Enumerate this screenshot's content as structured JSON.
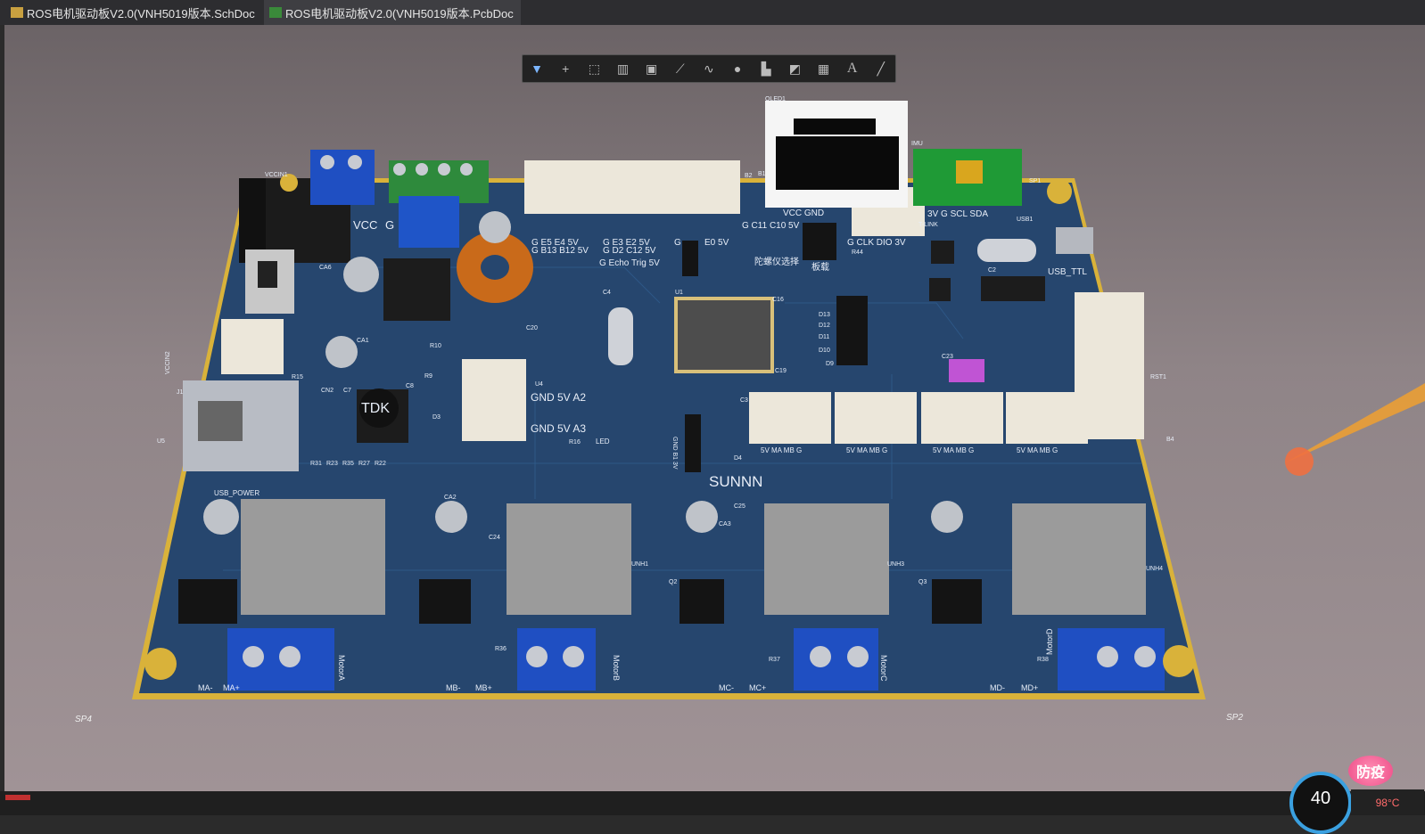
{
  "tabs": [
    {
      "label": "ROS电机驱动板V2.0(VNH5019版本.SchDoc",
      "icon": "schematic-doc-icon"
    },
    {
      "label": "ROS电机驱动板V2.0(VNH5019版本.PcbDoc",
      "icon": "pcb-doc-icon"
    }
  ],
  "toolbar": {
    "tools": [
      "filter-icon",
      "cross-icon",
      "select-rect-icon",
      "align-icon",
      "component-icon",
      "route-icon",
      "wave-icon",
      "pad-icon",
      "fill-icon",
      "region-icon",
      "chart-icon",
      "text-icon",
      "line-icon"
    ],
    "text_tool_label": "A"
  },
  "board": {
    "silk_logo": "SUNNN",
    "headers": {
      "h1a": "G E5 E4 5V",
      "h1b": "G B13 B12 5V",
      "h2a": "G E3 E2 5V",
      "h2b": "G D2 C12 5V",
      "h3a": "G",
      "h3b": "E0 5V",
      "echo": "G Echo Trig 5V",
      "oled": "VCC GND",
      "c11": "G C11 C10 5V",
      "imu": "3V G SCL SDA",
      "swd": "G CLK DIO 3V",
      "cn_gyro": "陀螺仪选择",
      "cn_board": "板载",
      "usb_ttl": "USB_TTL",
      "vcc": "VCC",
      "g": "G",
      "a2": "GND 5V A2",
      "a3": "GND 5V A3",
      "led": "LED",
      "usb_power": "USB_POWER",
      "tdk": "TDK",
      "motor_pins": "5V  MA  MB  G",
      "gnd_b1": "GND B1 3V"
    },
    "motors": [
      "MotorA",
      "MotorB",
      "MotorC",
      "MotorD"
    ],
    "motor_terms": {
      "a": [
        "MA-",
        "MA+"
      ],
      "b": [
        "MB-",
        "MB+"
      ],
      "c": [
        "MC-",
        "MC+"
      ],
      "d": [
        "MD-",
        "MD+"
      ]
    },
    "corner_labels": [
      "SP4",
      "SP2"
    ],
    "refs": [
      "U1",
      "U4",
      "C19",
      "C16",
      "R44",
      "C23",
      "RST1",
      "B4",
      "D3",
      "R16",
      "D4",
      "Q2",
      "Q3",
      "R36",
      "R37",
      "R38",
      "C24",
      "C25",
      "D13",
      "D12",
      "D11",
      "D10",
      "D9",
      "CN2",
      "C7",
      "C8",
      "R9",
      "R10",
      "R15",
      "CA1",
      "CA6",
      "CA2",
      "CA3",
      "C2",
      "C3",
      "C4",
      "C20",
      "J1",
      "U5",
      "USB1",
      "SP1",
      "B2",
      "B1",
      "OLED1",
      "IMU",
      "UNH1",
      "UNH3",
      "UNH4",
      "R31",
      "R23",
      "R35",
      "R27",
      "R22",
      "VCCIN1",
      "VCCIN2",
      "T-LINK"
    ]
  },
  "overlay": {
    "badge": "防疫",
    "gauge_value": "40",
    "temp": "98°C"
  }
}
